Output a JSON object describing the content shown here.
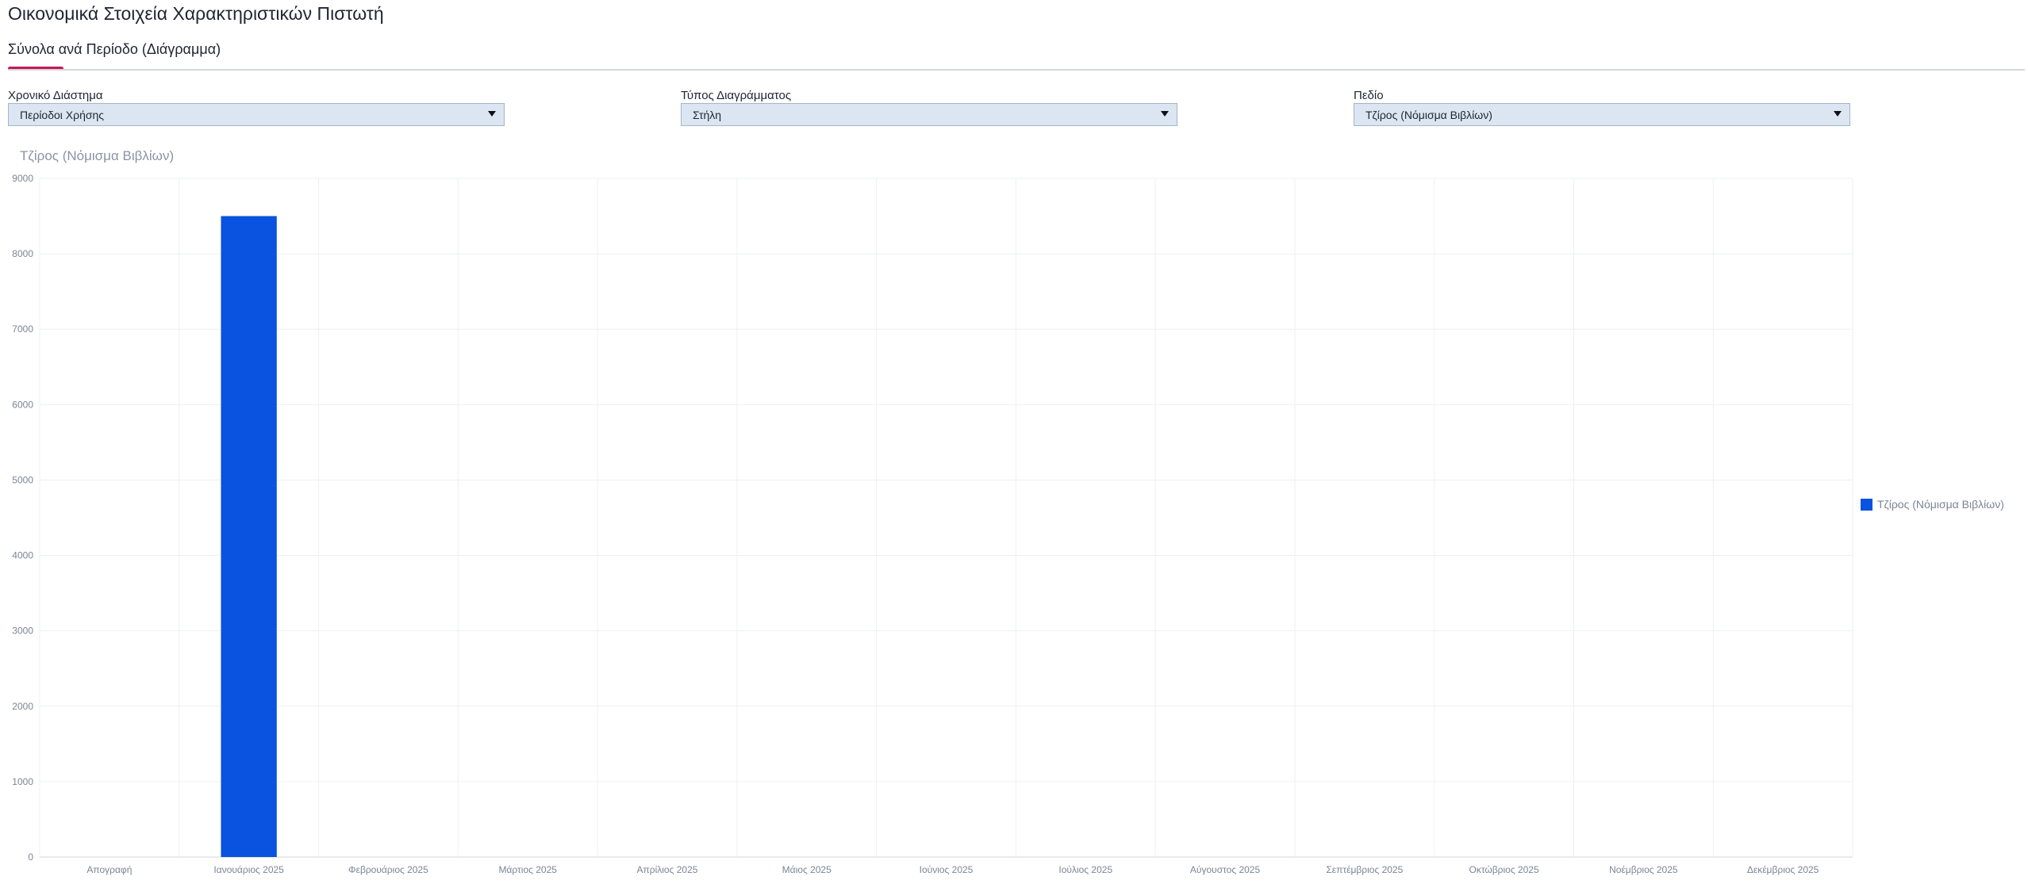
{
  "page": {
    "title": "Οικονομικά Στοιχεία Χαρακτηριστικών Πιστωτή",
    "tab_label": "Σύνολα ανά Περίοδο (Διάγραμμα)"
  },
  "filters": {
    "period": {
      "label": "Χρονικό Διάστημα",
      "value": "Περίοδοι Χρήσης"
    },
    "chart_type": {
      "label": "Τύπος Διαγράμματος",
      "value": "Στήλη"
    },
    "field": {
      "label": "Πεδίο",
      "value": "Τζίρος (Νόμισμα Βιβλίων)"
    }
  },
  "colors": {
    "bar": "#0a52e0",
    "accent": "#c2185b"
  },
  "chart_data": {
    "type": "bar",
    "title": "Τζίρος (Νόμισμα Βιβλίων)",
    "categories": [
      "Απογραφή",
      "Ιανουάριος 2025",
      "Φεβρουάριος 2025",
      "Μάρτιος 2025",
      "Απρίλιος 2025",
      "Μάιος 2025",
      "Ιούνιος 2025",
      "Ιούλιος 2025",
      "Αύγουστος 2025",
      "Σεπτέμβριος 2025",
      "Οκτώβριος 2025",
      "Νοέμβριος 2025",
      "Δεκέμβριος 2025"
    ],
    "series": [
      {
        "name": "Τζίρος (Νόμισμα Βιβλίων)",
        "values": [
          0,
          8500,
          0,
          0,
          0,
          0,
          0,
          0,
          0,
          0,
          0,
          0,
          0
        ]
      }
    ],
    "ylim": [
      0,
      9000
    ],
    "yticks": [
      0,
      1000,
      2000,
      3000,
      4000,
      5000,
      6000,
      7000,
      8000,
      9000
    ],
    "grid": true,
    "legend": "right"
  }
}
